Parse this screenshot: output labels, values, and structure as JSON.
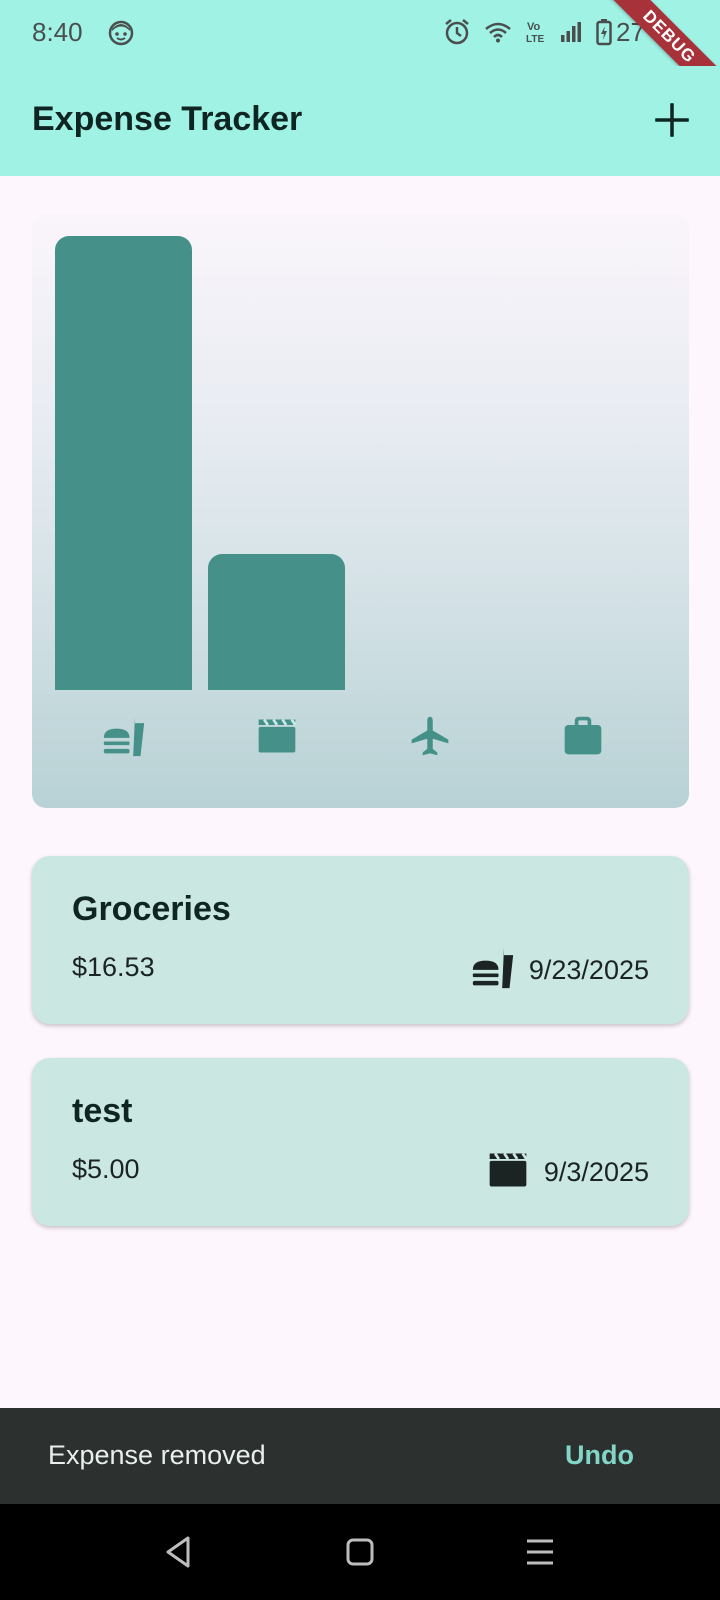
{
  "status_bar": {
    "time": "8:40",
    "battery": "27",
    "icons": [
      "face-icon",
      "alarm-icon",
      "wifi-icon",
      "volte-icon",
      "signal-icon",
      "battery-charging-icon"
    ]
  },
  "debug_banner": "DEBUG",
  "app_bar": {
    "title": "Expense Tracker",
    "action_icon": "add-icon"
  },
  "chart": {
    "categories": [
      "food",
      "leisure",
      "travel",
      "work"
    ],
    "category_icons": [
      "fastfood-icon",
      "movie-icon",
      "flight-icon",
      "work-icon"
    ],
    "relative_totals": [
      1.0,
      0.3,
      0,
      0
    ],
    "bar_color": "#45918a"
  },
  "expenses": [
    {
      "title": "Groceries",
      "amount": "$16.53",
      "category_icon": "fastfood-icon",
      "date": "9/23/2025"
    },
    {
      "title": "test",
      "amount": "$5.00",
      "category_icon": "movie-icon",
      "date": "9/3/2025"
    }
  ],
  "snackbar": {
    "message": "Expense removed",
    "action": "Undo"
  },
  "nav": {
    "buttons": [
      "back-icon",
      "home-icon",
      "recents-icon"
    ]
  },
  "colors": {
    "app_bar": "#a0f2e5",
    "background": "#fdf7fd",
    "card": "#cbe7e2",
    "accent": "#45918a",
    "snackbar": "#2c3130",
    "snackbar_action": "#82d6c8"
  }
}
